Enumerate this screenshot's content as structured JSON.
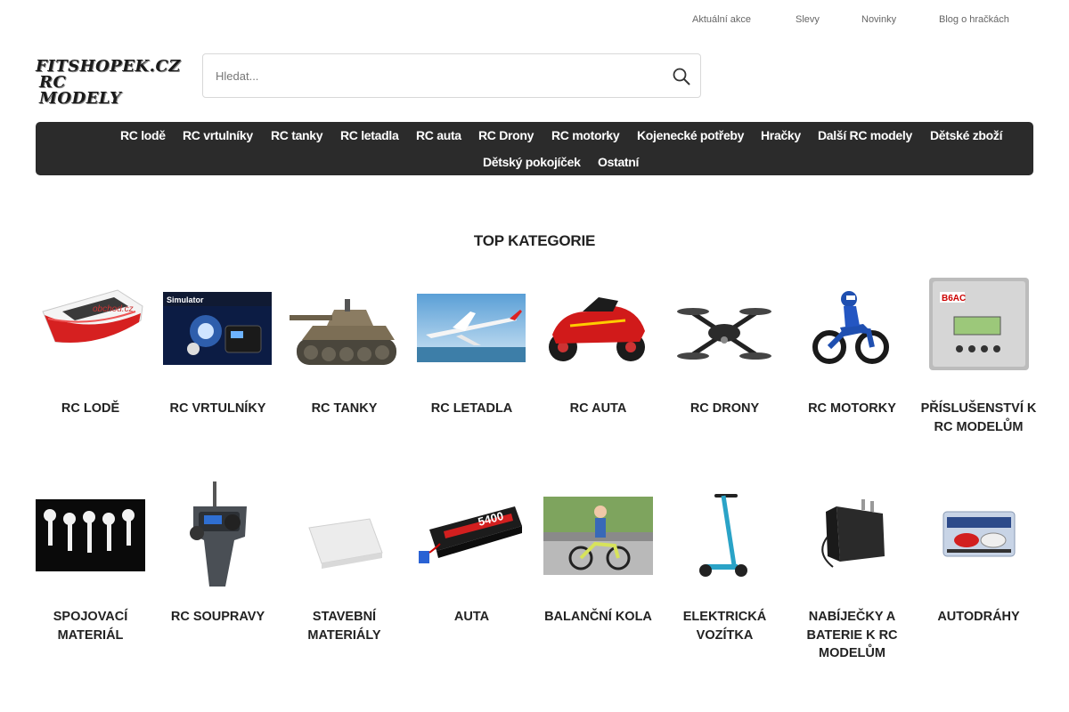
{
  "top_links": [
    "Aktuální akce",
    "Slevy",
    "Novinky",
    "Blog o hračkách"
  ],
  "logo": {
    "line1": "FITSHOPEK.CZ",
    "line2": "RC MODELY",
    "watermark": "obchod.cz"
  },
  "search": {
    "placeholder": "Hledat...",
    "value": "",
    "icon": "search-icon"
  },
  "nav": {
    "row1": [
      "RC lodě",
      "RC vrtulníky",
      "RC tanky",
      "RC letadla",
      "RC auta",
      "RC Drony",
      "RC motorky",
      "Kojenecké potřeby",
      "Hračky",
      "Další RC modely",
      "Dětské zboží"
    ],
    "row2": [
      "Dětský pokojíček",
      "Ostatní"
    ]
  },
  "section_title": "TOP KATEGORIE",
  "categories_row1": [
    {
      "label": "RC lodě",
      "image": "rc-boat"
    },
    {
      "label": "RC vrtulníky",
      "image": "rc-helicopter-simulator"
    },
    {
      "label": "RC tanky",
      "image": "rc-tank"
    },
    {
      "label": "RC letadla",
      "image": "rc-plane"
    },
    {
      "label": "RC auta",
      "image": "rc-car"
    },
    {
      "label": "RC Drony",
      "image": "rc-drone"
    },
    {
      "label": "RC motorky",
      "image": "rc-motorbike"
    },
    {
      "label": "Příslušenství k RC modelům",
      "image": "charger-accessory",
      "image_text": "B6AC"
    }
  ],
  "categories_row2": [
    {
      "label": "Spojovací materiál",
      "image": "screws"
    },
    {
      "label": "RC soupravy",
      "image": "rc-transmitter"
    },
    {
      "label": "Stavební materiály",
      "image": "building-board"
    },
    {
      "label": "Auta",
      "image": "battery-pack",
      "image_text": "5400"
    },
    {
      "label": "Balanční kola",
      "image": "balance-bike"
    },
    {
      "label": "Elektrická vozítka",
      "image": "electric-scooter"
    },
    {
      "label": "Nabíječky a baterie k RC modelům",
      "image": "power-adapter"
    },
    {
      "label": "Autodráhy",
      "image": "slot-car-track"
    }
  ]
}
